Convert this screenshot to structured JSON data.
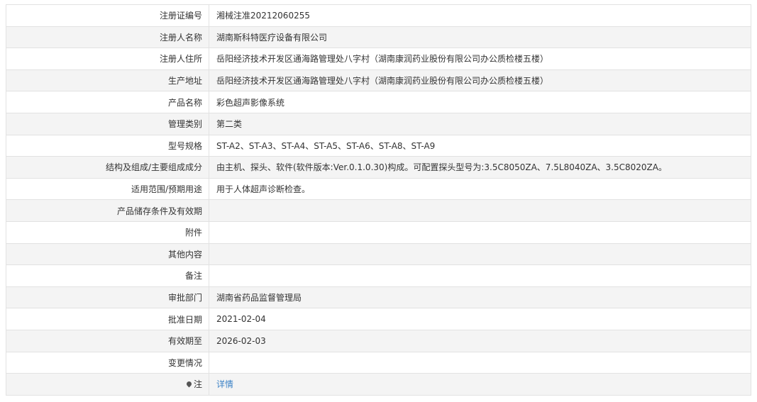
{
  "rows": [
    {
      "label": "注册证编号",
      "value": "湘械注准20212060255"
    },
    {
      "label": "注册人名称",
      "value": "湖南斯科特医疗设备有限公司"
    },
    {
      "label": "注册人住所",
      "value": "岳阳经济技术开发区通海路管理处八字村（湖南康润药业股份有限公司办公质检楼五楼）"
    },
    {
      "label": "生产地址",
      "value": "岳阳经济技术开发区通海路管理处八字村（湖南康润药业股份有限公司办公质检楼五楼）"
    },
    {
      "label": "产品名称",
      "value": "彩色超声影像系统"
    },
    {
      "label": "管理类别",
      "value": "第二类"
    },
    {
      "label": "型号规格",
      "value": "ST-A2、ST-A3、ST-A4、ST-A5、ST-A6、ST-A8、ST-A9"
    },
    {
      "label": "结构及组成/主要组成成分",
      "value": "由主机、探头、软件(软件版本:Ver.0.1.0.30)构成。可配置探头型号为:3.5C8050ZA、7.5L8040ZA、3.5C8020ZA。"
    },
    {
      "label": "适用范围/预期用途",
      "value": "用于人体超声诊断检查。"
    },
    {
      "label": "产品储存条件及有效期",
      "value": ""
    },
    {
      "label": "附件",
      "value": ""
    },
    {
      "label": "其他内容",
      "value": ""
    },
    {
      "label": "备注",
      "value": ""
    },
    {
      "label": "审批部门",
      "value": "湖南省药品监督管理局"
    },
    {
      "label": "批准日期",
      "value": "2021-02-04"
    },
    {
      "label": "有效期至",
      "value": "2026-02-03"
    },
    {
      "label": "变更情况",
      "value": ""
    }
  ],
  "note": {
    "label": "注",
    "icon": "map-pin-icon",
    "link_text": "详情"
  },
  "colors": {
    "row_alt": "#f4f4f4",
    "border": "#e2e2e2",
    "link": "#3c82c6"
  }
}
